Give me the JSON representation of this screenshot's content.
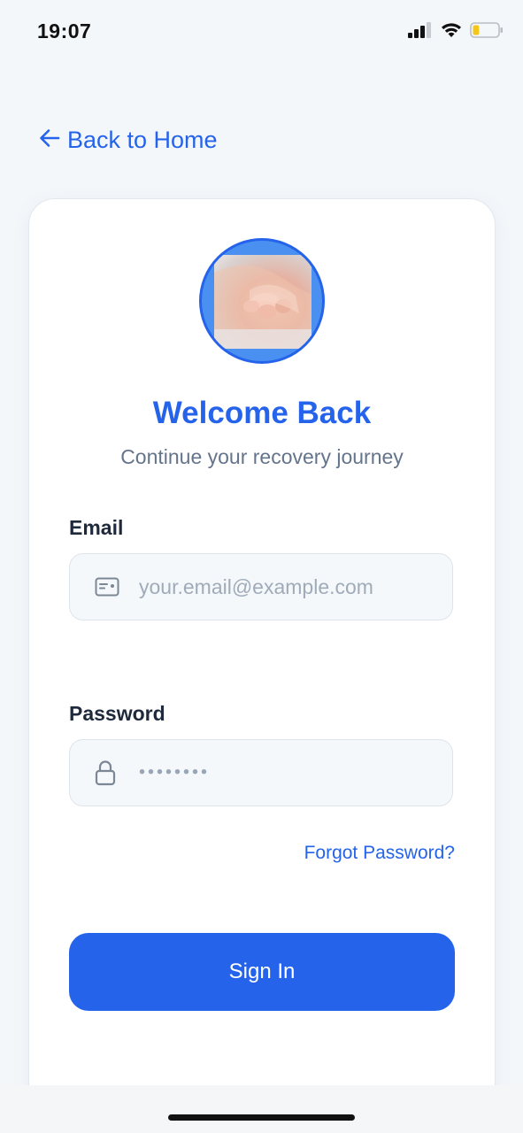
{
  "status_bar": {
    "time": "19:07",
    "signal_icon": "cellular-signal-icon",
    "wifi_icon": "wifi-icon",
    "battery_icon": "battery-icon",
    "battery_level": 0.25,
    "battery_color": "#f5c518"
  },
  "nav": {
    "back_label": "Back to Home",
    "back_icon": "arrow-left-icon"
  },
  "login": {
    "title": "Welcome Back",
    "subtitle": "Continue your recovery journey",
    "email": {
      "label": "Email",
      "placeholder": "your.email@example.com",
      "value": "",
      "icon": "id-card-icon"
    },
    "password": {
      "label": "Password",
      "masked_value": "••••••••",
      "icon": "lock-icon"
    },
    "forgot_label": "Forgot Password?",
    "submit_label": "Sign In"
  },
  "colors": {
    "accent": "#2563eb",
    "background": "#f4f7fa",
    "card": "#ffffff",
    "muted_text": "#64748b"
  }
}
